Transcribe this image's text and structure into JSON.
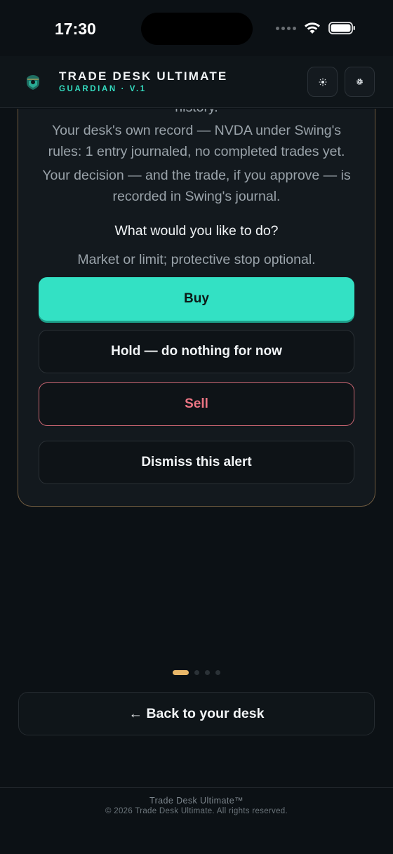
{
  "status_bar": {
    "time": "17:30"
  },
  "header": {
    "title": "TRADE DESK ULTIMATE",
    "subtitle": "GUARDIAN · V.1",
    "theme_icon": "sun-icon",
    "settings_icon": "gear-icon"
  },
  "alert": {
    "history_tail": "history.",
    "record_text": "Your desk's own record — NVDA under Swing's rules: 1 entry journaled, no completed trades yet.",
    "decision_text": "Your decision — and the trade, if you approve — is recorded in Swing's journal.",
    "question": "What would you like to do?",
    "hint": "Market or limit; protective stop optional.",
    "buy_label": "Buy",
    "hold_label": "Hold — do nothing for now",
    "sell_label": "Sell",
    "dismiss_label": "Dismiss this alert"
  },
  "pager": {
    "total": 4,
    "current": 1
  },
  "back_button": {
    "label": "← Back to your desk"
  },
  "footer": {
    "brand": "Trade Desk Ultimate™",
    "copyright": "© 2026 Trade Desk Ultimate. All rights reserved."
  },
  "colors": {
    "accent_teal": "#33e1c4",
    "sell_red": "#eb7583",
    "card_border_gold": "#6e5a3f",
    "pager_active": "#eab86a"
  }
}
